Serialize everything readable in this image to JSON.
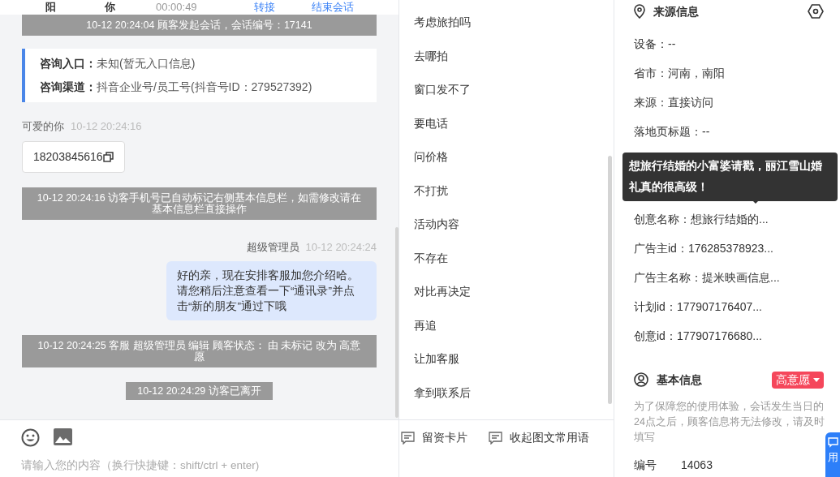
{
  "header": {
    "items": [
      {
        "text": "阳",
        "kind": "name"
      },
      {
        "text": "你",
        "kind": "name"
      },
      {
        "text": "00:00:49",
        "kind": "timer"
      },
      {
        "text": "转接",
        "kind": "link"
      },
      {
        "text": "结束会话",
        "kind": "link"
      }
    ]
  },
  "chat": {
    "messages": [
      {
        "kind": "system",
        "text": "10-12 20:24:04 顾客发起会话，会话编号：17141"
      },
      {
        "kind": "info",
        "rows": [
          {
            "label": "咨询入口：",
            "value": "未知(暂无入口信息)"
          },
          {
            "label": "咨询渠道：",
            "value": "抖音企业号/员工号(抖音号ID：279527392)"
          }
        ]
      },
      {
        "kind": "visitor",
        "sender": "可爱的你",
        "time": "10-12 20:24:16",
        "text": "18203845616"
      },
      {
        "kind": "system",
        "text": "10-12 20:24:16 访客手机号已自动标记右侧基本信息栏，如需修改请在基本信息栏直接操作"
      },
      {
        "kind": "agent",
        "sender": "超级管理员",
        "time": "10-12 20:24:24",
        "text": "好的亲，现在安排客服加您介绍哈。请您稍后注意查看一下“通讯录”并点击“新的朋友”通过下哦"
      },
      {
        "kind": "system",
        "text": "10-12 20:24:25 客服 超级管理员 编辑 顾客状态： 由 未标记 改为 高意愿"
      },
      {
        "kind": "system",
        "text": "10-12 20:24:29 访客已离开"
      }
    ],
    "input": {
      "placeholder": "请输入您的内容（换行快捷键：shift/ctrl + enter)"
    }
  },
  "quick_replies": {
    "items": [
      "考虑旅拍吗",
      "去哪拍",
      "窗口发不了",
      "要电话",
      "问价格",
      "不打扰",
      "活动内容",
      "不存在",
      "对比再决定",
      "再追",
      "让加客服",
      "拿到联系后"
    ],
    "buttons": [
      "留资卡片",
      "收起图文常用语"
    ]
  },
  "source_info": {
    "title": "来源信息",
    "rows_before": [
      "设备：--",
      "省市：河南，南阳",
      "来源：直接访问",
      "落地页标题：--"
    ],
    "tooltip": "想旅行结婚的小富婆请戳，丽江雪山婚礼真的很高级！",
    "rows_after": [
      "创意名称：想旅行结婚的...",
      "广告主id：176285378923...",
      "广告主名称：提米映画信息...",
      "计划id：177907176407...",
      "创意id：177907176680..."
    ]
  },
  "basic_info": {
    "title": "基本信息",
    "status": {
      "label": "高意愿",
      "color": "#f5475b"
    },
    "notice": "为了保障您的使用体验，会话发生当日的24点之后，顾客信息将无法修改，请及时填写",
    "fields": [
      {
        "label": "编号",
        "value": "14063"
      }
    ]
  },
  "float_button": {
    "label": "用"
  }
}
